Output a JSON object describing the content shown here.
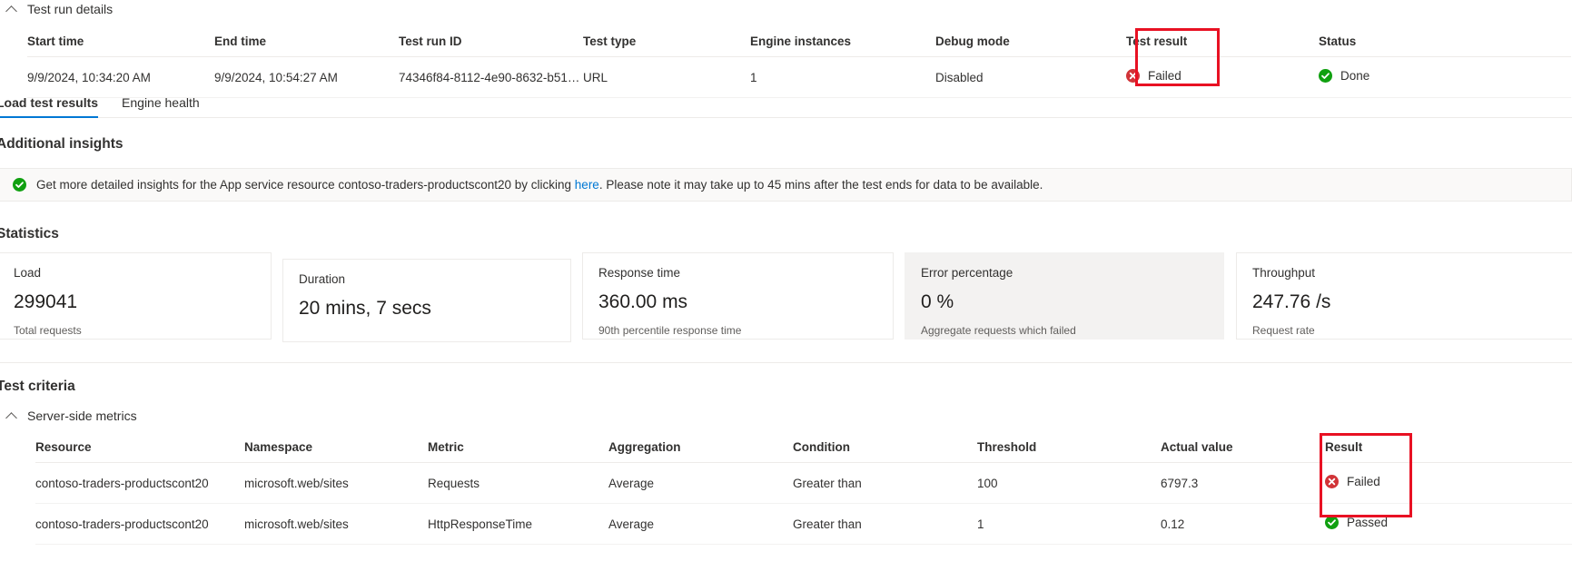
{
  "details_section": {
    "title": "Test run details",
    "columns": [
      "Start time",
      "End time",
      "Test run ID",
      "Test type",
      "Engine instances",
      "Debug mode",
      "Test result",
      "Status"
    ],
    "row": {
      "start_time": "9/9/2024, 10:34:20 AM",
      "end_time": "9/9/2024, 10:54:27 AM",
      "test_run_id": "74346f84-8112-4e90-8632-b51773b...",
      "test_type": "URL",
      "engine_instances": "1",
      "debug_mode": "Disabled",
      "test_result": "Failed",
      "test_result_icon": "error-circle-icon",
      "status": "Done",
      "status_icon": "success-circle-icon"
    }
  },
  "tabs": [
    {
      "label": "Load test results",
      "selected": true
    },
    {
      "label": "Engine health",
      "selected": false
    }
  ],
  "insights": {
    "heading": "Additional insights",
    "icon": "success-circle-icon",
    "text_before_link": "Get more detailed insights for the App service resource contoso-traders-productscont20 by clicking ",
    "link_text": "here",
    "text_after_link": ". Please note it may take up to 45 mins after the test ends for data to be available."
  },
  "statistics": {
    "heading": "Statistics",
    "cards": [
      {
        "title": "Load",
        "value": "299041",
        "sub": "Total requests",
        "hover": false
      },
      {
        "title": "Duration",
        "value": "20 mins, 7 secs",
        "sub": "",
        "hover": false
      },
      {
        "title": "Response time",
        "value": "360.00 ms",
        "sub": "90th percentile response time",
        "hover": false
      },
      {
        "title": "Error percentage",
        "value": "0 %",
        "sub": "Aggregate requests which failed",
        "hover": true
      },
      {
        "title": "Throughput",
        "value": "247.76 /s",
        "sub": "Request rate",
        "hover": false
      }
    ]
  },
  "test_criteria": {
    "heading": "Test criteria",
    "group_label": "Server-side metrics",
    "columns": [
      "Resource",
      "Namespace",
      "Metric",
      "Aggregation",
      "Condition",
      "Threshold",
      "Actual value",
      "Result"
    ],
    "rows": [
      {
        "resource": "contoso-traders-productscont20",
        "namespace": "microsoft.web/sites",
        "metric": "Requests",
        "aggregation": "Average",
        "condition": "Greater than",
        "threshold": "100",
        "actual_value": "6797.3",
        "result": "Failed",
        "result_icon": "error-circle-icon"
      },
      {
        "resource": "contoso-traders-productscont20",
        "namespace": "microsoft.web/sites",
        "metric": "HttpResponseTime",
        "aggregation": "Average",
        "condition": "Greater than",
        "threshold": "1",
        "actual_value": "0.12",
        "result": "Passed",
        "result_icon": "success-circle-icon"
      }
    ]
  },
  "colors": {
    "accent": "#0078d4",
    "error": "#d13438",
    "success": "#107c10",
    "annotation": "#e81123"
  }
}
